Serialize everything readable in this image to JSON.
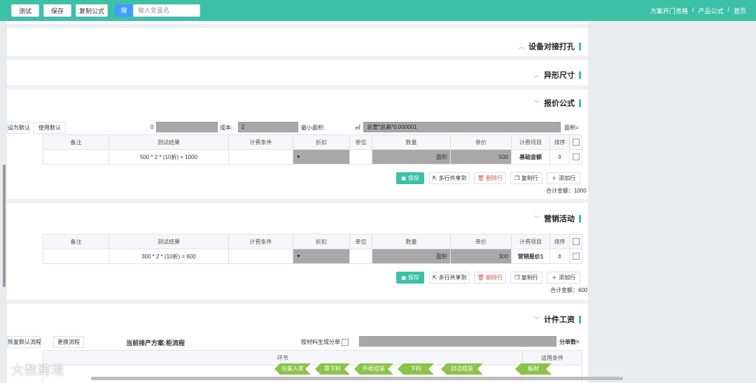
{
  "topbar": {
    "breadcrumb": [
      "首页",
      "/",
      "产品公式",
      "/",
      "方案开门青格"
    ],
    "input_placeholder": "输入变量名",
    "search_label": "搜",
    "btn_formula": "复制公式",
    "btn_save": "保存",
    "btn_test": "测试"
  },
  "sections": {
    "hole": "设备对接打孔",
    "shape": "异形尺寸",
    "formula": "报价公式",
    "marketing": "营销活动",
    "piecework": "计件工资"
  },
  "formula": {
    "area_label": "面积=",
    "area_value": "总宽*总高*0.000001",
    "area_unit": "㎡",
    "min_area_label": "最小面积:",
    "min_area_value": "2",
    "cost_label": "成本:",
    "cost_value": "0",
    "use_default": "使用默认",
    "set_default": "设为默认",
    "headers": [
      "排序",
      "计费项目",
      "单价",
      "数量",
      "单位",
      "折扣",
      "计费条件",
      "测试结果",
      "备注"
    ],
    "row": {
      "item": "基础金额",
      "price": "500",
      "qty": "面积",
      "result": "500 * 2 * (10折) = 1000"
    },
    "btn_add": "添加行",
    "btn_copy": "复制行",
    "btn_delete": "删除行",
    "btn_multi": "多行共享到",
    "btn_save": "保存",
    "total": "合计金额：1000"
  },
  "marketing": {
    "headers": [
      "排序",
      "计费项目",
      "单价",
      "数量",
      "单位",
      "折扣",
      "计费条件",
      "测试结果",
      "备注"
    ],
    "row": {
      "item": "营销报价1",
      "price": "300",
      "qty": "面积",
      "result": "300 * 2 * (10折) = 600"
    },
    "btn_add": "添加行",
    "btn_copy": "复制行",
    "btn_delete": "删除行",
    "btn_multi": "多行共享到",
    "btn_save": "保存",
    "total": "合计金额：600"
  },
  "piecework": {
    "split_label": "分单数=",
    "check_label": "按材料生成分单",
    "current_plan": "当前排产方案:柜流程",
    "btn_change": "更换流程",
    "btn_restore": "恢复默认流程",
    "col_condition": "适用条件",
    "col_process": "环节",
    "steps": [
      "板材",
      "封边组装",
      "下料",
      "外框组装",
      "靠下料",
      "包装入库"
    ]
  },
  "watermark": "大数跨境"
}
